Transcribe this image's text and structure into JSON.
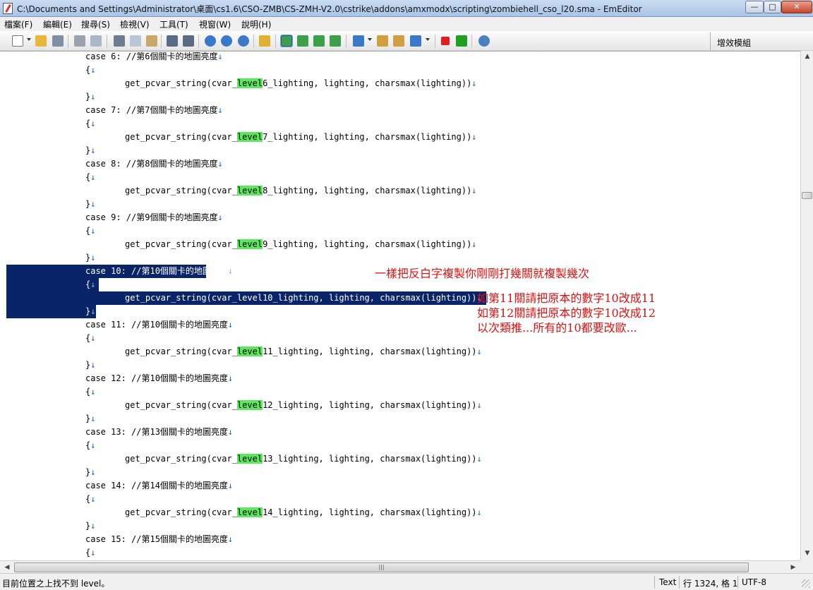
{
  "window": {
    "title": "C:\\Documents and Settings\\Administrator\\桌面\\cs1.6\\CSO-ZMB\\CS-ZMH-V2.0\\cstrike\\addons\\amxmodx\\scripting\\zombiehell_cso_l20.sma - EmEditor",
    "minimize_glyph": "—",
    "maximize_glyph": "□",
    "close_glyph": "✕"
  },
  "menu": {
    "items": [
      {
        "label": "檔案(F)"
      },
      {
        "label": "編輯(E)"
      },
      {
        "label": "搜尋(S)"
      },
      {
        "label": "檢視(V)"
      },
      {
        "label": "工具(T)"
      },
      {
        "label": "視窗(W)"
      },
      {
        "label": "說明(H)"
      }
    ]
  },
  "toolbar": {
    "icons": [
      {
        "name": "new-file-icon",
        "color": "#ffffff"
      },
      {
        "name": "open-file-icon",
        "color": "#e8b83a"
      },
      {
        "name": "save-icon",
        "color": "#7f8fa6"
      },
      {
        "name": "print-icon",
        "color": "#9aa3ad"
      },
      {
        "name": "print-preview-icon",
        "color": "#a9b7c6"
      },
      {
        "name": "cut-icon",
        "color": "#6d7c90"
      },
      {
        "name": "copy-icon",
        "color": "#b9c6d6"
      },
      {
        "name": "paste-icon",
        "color": "#c9a86a"
      },
      {
        "name": "undo-icon",
        "color": "#5a6c84"
      },
      {
        "name": "redo-icon",
        "color": "#5a6c84"
      },
      {
        "name": "find-icon",
        "color": "#3a78c9"
      },
      {
        "name": "find-next-icon",
        "color": "#3a78c9"
      },
      {
        "name": "find-prev-icon",
        "color": "#3a78c9"
      },
      {
        "name": "find-in-files-icon",
        "color": "#e0b030"
      },
      {
        "name": "wrap-none-icon",
        "color": "#3ca04a"
      },
      {
        "name": "wrap-window-icon",
        "color": "#3ca04a"
      },
      {
        "name": "wrap-column-icon",
        "color": "#3ca04a"
      },
      {
        "name": "wrap-page-icon",
        "color": "#3ca04a"
      },
      {
        "name": "config-icon",
        "color": "#3a78c9"
      },
      {
        "name": "properties-icon",
        "color": "#d0a040"
      },
      {
        "name": "customize-icon",
        "color": "#d0a040"
      },
      {
        "name": "macro-select-icon",
        "color": "#3a78c9"
      },
      {
        "name": "macro-stop-icon",
        "color": "#e02020"
      },
      {
        "name": "macro-run-icon",
        "color": "#20a020"
      },
      {
        "name": "plugin-icon",
        "color": "#4a80c0"
      }
    ]
  },
  "plugin_panel": {
    "title": "增效模組"
  },
  "editor": {
    "lines": [
      {
        "text": "case 6: //第6個關卡的地圖亮度"
      },
      {
        "text": "{"
      },
      {
        "pre": "get_pcvar_string(cvar_",
        "hl": "level",
        "post": "6_lighting, lighting, charsmax(lighting))"
      },
      {
        "text": "}"
      },
      {
        "text": "case 7: //第7個關卡的地圖亮度"
      },
      {
        "text": "{"
      },
      {
        "pre": "get_pcvar_string(cvar_",
        "hl": "level",
        "post": "7_lighting, lighting, charsmax(lighting))"
      },
      {
        "text": "}"
      },
      {
        "text": "case 8: //第8個關卡的地圖亮度"
      },
      {
        "text": "{"
      },
      {
        "pre": "get_pcvar_string(cvar_",
        "hl": "level",
        "post": "8_lighting, lighting, charsmax(lighting))"
      },
      {
        "text": "}"
      },
      {
        "text": "case 9: //第9個關卡的地圖亮度"
      },
      {
        "text": "{"
      },
      {
        "pre": "get_pcvar_string(cvar_",
        "hl": "level",
        "post": "9_lighting, lighting, charsmax(lighting))"
      },
      {
        "text": "}"
      },
      {
        "text": "case 10: //第10個關卡的地圖亮度",
        "selected": true
      },
      {
        "text": "{",
        "selected": true
      },
      {
        "text": "get_pcvar_string(cvar_level10_lighting, lighting, charsmax(lighting))",
        "selected": true
      },
      {
        "text": "}",
        "selected": true
      },
      {
        "text": "case 11: //第10個關卡的地圖亮度"
      },
      {
        "text": "{"
      },
      {
        "pre": "get_pcvar_string(cvar_",
        "hl": "level",
        "post": "11_lighting, lighting, charsmax(lighting))"
      },
      {
        "text": "}"
      },
      {
        "text": "case 12: //第10個關卡的地圖亮度"
      },
      {
        "text": "{"
      },
      {
        "pre": "get_pcvar_string(cvar_",
        "hl": "level",
        "post": "12_lighting, lighting, charsmax(lighting))"
      },
      {
        "text": "}"
      },
      {
        "text": "case 13: //第13個關卡的地圖亮度"
      },
      {
        "text": "{"
      },
      {
        "pre": "get_pcvar_string(cvar_",
        "hl": "level",
        "post": "13_lighting, lighting, charsmax(lighting))"
      },
      {
        "text": "}"
      },
      {
        "text": "case 14: //第14個關卡的地圖亮度"
      },
      {
        "text": "{"
      },
      {
        "pre": "get_pcvar_string(cvar_",
        "hl": "level",
        "post": "14_lighting, lighting, charsmax(lighting))"
      },
      {
        "text": "}"
      },
      {
        "text": "case 15: //第15個關卡的地圖亮度"
      },
      {
        "text": "{"
      }
    ],
    "newline_glyph": "↓"
  },
  "annotations": {
    "line1": "一樣把反白字複製你剛剛打幾關就複製幾次",
    "line2": "如第11關請把原本的數字10改成11",
    "line3": "如第12關請把原本的數字10改成12",
    "line4": "以次類推...所有的10都要改歐..."
  },
  "scrollbars": {
    "up": "▲",
    "down": "▼",
    "left": "◀",
    "right": "▶",
    "grip": "|||"
  },
  "status": {
    "message": "目前位置之上找不到 level。",
    "mode": "Text",
    "position": "行 1324, 格 1",
    "encoding": "UTF-8"
  }
}
